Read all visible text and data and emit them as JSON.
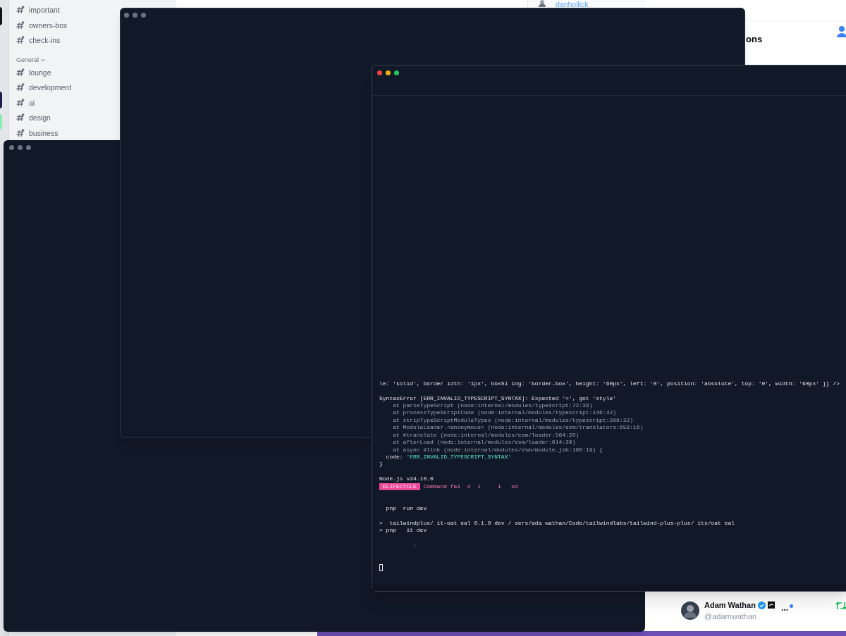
{
  "chat_sidebar": {
    "channels_top": [
      {
        "label": "important"
      },
      {
        "label": "owners-box"
      },
      {
        "label": "check-ins"
      }
    ],
    "section": {
      "label": "General",
      "expanded": true
    },
    "channels": [
      {
        "label": "lounge"
      },
      {
        "label": "development"
      },
      {
        "label": "ai"
      },
      {
        "label": "design"
      },
      {
        "label": "business"
      }
    ]
  },
  "member_list": {
    "name": "danhollick"
  },
  "background_page": {
    "heading": "ons"
  },
  "terminal": {
    "lines": [
      [
        {
          "kind": "plain",
          "text": "le: 'solid', border idth: '1px', boxSi ing: 'border-box', height: '60px', left: '0', position: 'absolute', top: '0', width: '60px' }} />"
        }
      ],
      [
        {
          "kind": "blank"
        }
      ],
      [
        {
          "kind": "plain",
          "text": "SyntaxError [ERR_INVALID_TYPESCRIPT_SYNTAX]: Expected '>', got 'style'"
        }
      ],
      [
        {
          "kind": "dim",
          "text": "    at parseTypeScript (node:internal/modules/typescript:72:36)"
        }
      ],
      [
        {
          "kind": "dim",
          "text": "    at processTypeScriptCode (node:internal/modules/typescript:146:42)"
        }
      ],
      [
        {
          "kind": "dim",
          "text": "    at stripTypeScriptModuleTypes (node:internal/modules/typescript:209:22)"
        }
      ],
      [
        {
          "kind": "dim",
          "text": "    at ModuleLoader.<anonymous> (node:internal/modules/esm/translators:658:16)"
        }
      ],
      [
        {
          "kind": "dim",
          "text": "    at #translate (node:internal/modules/esm/loader:564:20)"
        }
      ],
      [
        {
          "kind": "dim",
          "text": "    at afterLoad (node:internal/modules/esm/loader:614:29)"
        }
      ],
      [
        {
          "kind": "dim",
          "text": "    at async #link (node:internal/modules/esm/module_job:180:19) {"
        }
      ],
      [
        {
          "kind": "plain",
          "text": "  code: "
        },
        {
          "kind": "string",
          "text": "'ERR_INVALID_TYPESCRIPT_SYNTAX'"
        }
      ],
      [
        {
          "kind": "plain",
          "text": "}"
        }
      ],
      [
        {
          "kind": "blank"
        }
      ],
      [
        {
          "kind": "plain",
          "text": "Node.js v24.10.0"
        }
      ],
      [
        {
          "kind": "badge",
          "text": " ELIFECYCLE "
        },
        {
          "kind": "error",
          "text": " Command fai  d  i     i   od"
        }
      ],
      [
        {
          "kind": "blank"
        }
      ],
      [
        {
          "kind": "blank"
        }
      ],
      [
        {
          "kind": "plain",
          "text": "  pnp  run dev"
        }
      ],
      [
        {
          "kind": "blank"
        }
      ],
      [
        {
          "kind": "plain",
          "text": ">  tailwindplus/ it-oat eal 0.1.0 dev / sers/ada wathan/Code/tailwindlabs/tailwind-plus-plus/ its/oat eal"
        }
      ],
      [
        {
          "kind": "plain",
          "text": "> pnp   it dev"
        }
      ],
      [
        {
          "kind": "blank"
        }
      ],
      [
        {
          "kind": "plain",
          "text": "          :"
        }
      ],
      [
        {
          "kind": "blank"
        }
      ],
      [
        {
          "kind": "blank"
        }
      ],
      [
        {
          "kind": "cursor"
        }
      ]
    ]
  },
  "tweet": {
    "name": "Adam Wathan",
    "handle": "@adamwathan",
    "verified": true,
    "more": "...",
    "unread": true
  }
}
